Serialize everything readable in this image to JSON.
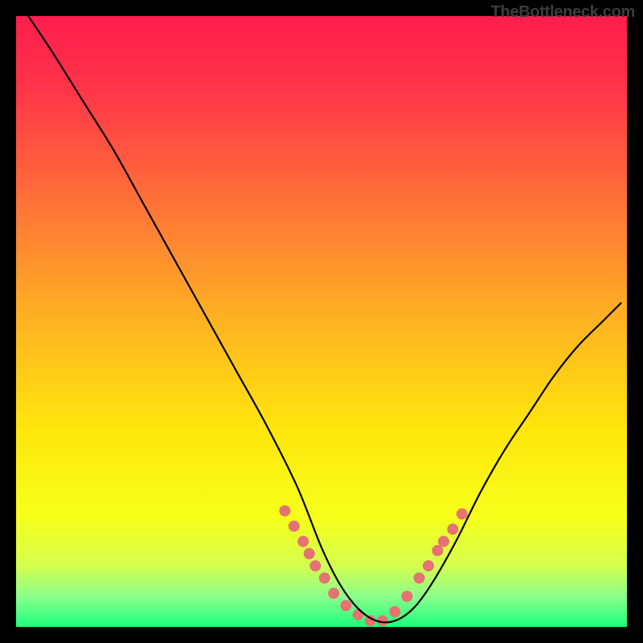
{
  "watermark": "TheBottleneck.com",
  "chart_data": {
    "type": "line",
    "title": "",
    "xlabel": "",
    "ylabel": "",
    "xlim": [
      0,
      100
    ],
    "ylim": [
      0,
      100
    ],
    "background_gradient": {
      "stops": [
        {
          "offset": 0.0,
          "color": "#ff1d4d"
        },
        {
          "offset": 0.12,
          "color": "#ff3449"
        },
        {
          "offset": 0.3,
          "color": "#ff7038"
        },
        {
          "offset": 0.5,
          "color": "#ffb321"
        },
        {
          "offset": 0.68,
          "color": "#ffe70c"
        },
        {
          "offset": 0.82,
          "color": "#f6ff1a"
        },
        {
          "offset": 0.9,
          "color": "#d4ff4e"
        },
        {
          "offset": 0.95,
          "color": "#8cff8c"
        },
        {
          "offset": 1.0,
          "color": "#1bff7b"
        }
      ]
    },
    "series": [
      {
        "name": "bottleneck-curve",
        "color": "#000000",
        "stroke_width": 2.2,
        "x": [
          2,
          6,
          11,
          16,
          21,
          26,
          31,
          36,
          41,
          46,
          50,
          53,
          56,
          59,
          62,
          65,
          68,
          72,
          76,
          80,
          84,
          88,
          92,
          96,
          99
        ],
        "y": [
          100,
          94,
          86,
          78,
          69,
          60,
          51,
          42,
          33,
          23,
          13,
          7,
          3,
          1,
          1,
          3,
          7,
          14,
          22,
          29,
          35,
          41,
          46,
          50,
          53
        ]
      }
    ],
    "highlight_points": {
      "name": "highlighted-range",
      "color": "#e57373",
      "radius": 7,
      "x": [
        44,
        45.5,
        47,
        48,
        49,
        50.5,
        52,
        54,
        56,
        58,
        60,
        62,
        64,
        66,
        67.5,
        69,
        70,
        71.5,
        73
      ],
      "y": [
        19,
        16.5,
        14,
        12,
        10,
        8,
        5.5,
        3.5,
        2,
        1,
        1,
        2.5,
        5,
        8,
        10,
        12.5,
        14,
        16,
        18.5
      ]
    }
  }
}
